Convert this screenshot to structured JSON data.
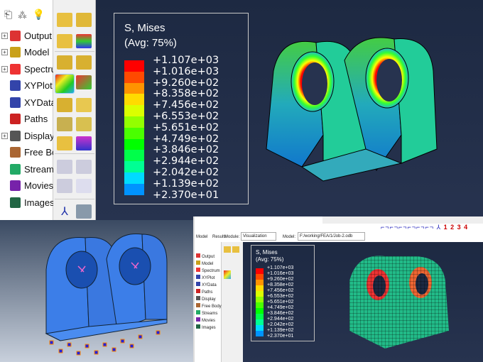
{
  "tree": {
    "items": [
      {
        "label": "Output",
        "expand": true,
        "color": "#d33"
      },
      {
        "label": "Model",
        "expand": true,
        "color": "#c9a11a"
      },
      {
        "label": "Spectrum",
        "expand": true,
        "color": "#e33"
      },
      {
        "label": "XYPlot",
        "expand": false,
        "color": "#34a"
      },
      {
        "label": "XYData",
        "expand": false,
        "color": "#34a"
      },
      {
        "label": "Paths",
        "expand": false,
        "color": "#c22"
      },
      {
        "label": "Display",
        "expand": true,
        "color": "#555"
      },
      {
        "label": "Free Body",
        "expand": false,
        "color": "#a63"
      },
      {
        "label": "Streams",
        "expand": false,
        "color": "#2a6"
      },
      {
        "label": "Movies",
        "expand": false,
        "color": "#72a"
      },
      {
        "label": "Images",
        "expand": false,
        "color": "#264"
      }
    ]
  },
  "legend": {
    "title": "S, Mises",
    "subtitle": "(Avg: 75%)",
    "values": [
      "+1.107e+03",
      "+1.016e+03",
      "+9.260e+02",
      "+8.358e+02",
      "+7.456e+02",
      "+6.553e+02",
      "+5.651e+02",
      "+4.749e+02",
      "+3.846e+02",
      "+2.944e+02",
      "+2.042e+02",
      "+1.139e+02",
      "+2.370e+01"
    ],
    "colors": [
      "#ff0000",
      "#ff4a00",
      "#ff9300",
      "#ffdb00",
      "#dbff00",
      "#93ff00",
      "#4aff00",
      "#00ff00",
      "#00ff4a",
      "#00ff93",
      "#00dbff",
      "#0093ff",
      "#004aff"
    ]
  },
  "bottom_window": {
    "tabs": [
      "Model",
      "Results"
    ],
    "module_label": "Module:",
    "module_value": "Visualization",
    "model_label": "Model:",
    "model_value": "F:/working/FEA/1/Job-2.odb",
    "view_numbers": [
      "1",
      "2",
      "3",
      "4"
    ]
  }
}
